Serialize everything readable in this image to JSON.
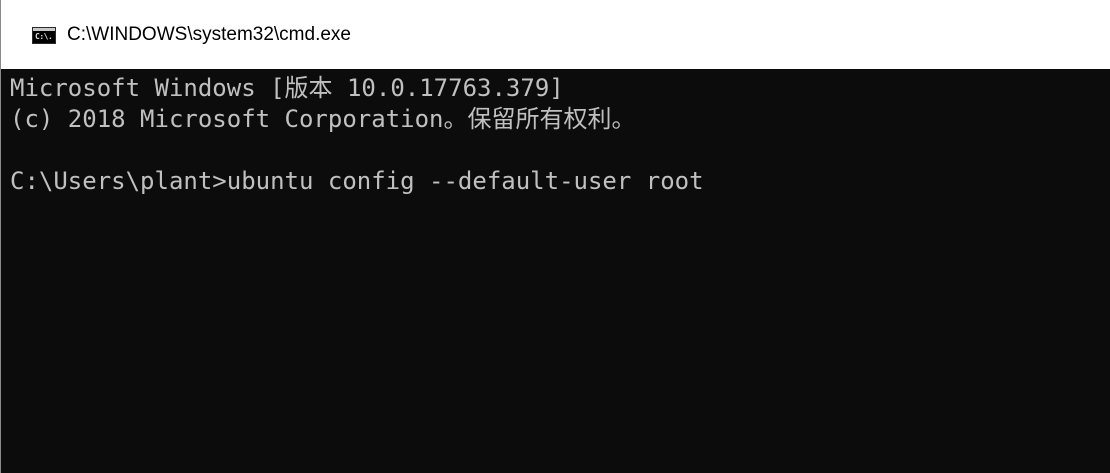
{
  "window": {
    "title": "C:\\WINDOWS\\system32\\cmd.exe",
    "icon": "cmd-icon",
    "icon_glyph": "C:\\.",
    "colors": {
      "console_background": "#0c0c0c",
      "console_text": "#c0c0c0",
      "titlebar_background": "#ffffff"
    }
  },
  "console": {
    "lines": [
      "Microsoft Windows [版本 10.0.17763.379]",
      "(c) 2018 Microsoft Corporation。保留所有权利。",
      "",
      "C:\\Users\\plant>ubuntu config --default-user root"
    ]
  }
}
